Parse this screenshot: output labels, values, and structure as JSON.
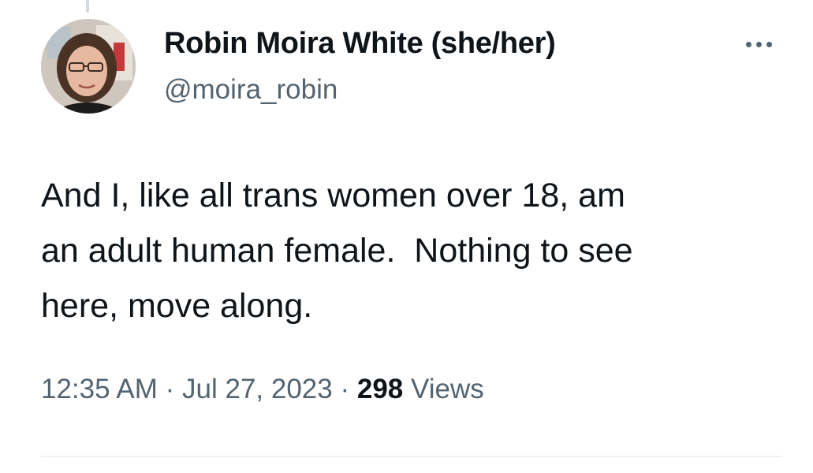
{
  "author": {
    "display_name": "Robin Moira White (she/her)",
    "handle": "@moira_robin"
  },
  "more_icon": "more-horizontal-icon",
  "tweet": {
    "text_lines": [
      "And I, like all trans women over 18, am",
      "an adult human female.  Nothing to see",
      "here, move along."
    ]
  },
  "meta": {
    "time": "12:35 AM",
    "separator": "·",
    "date": "Jul 27, 2023",
    "views_count": "298",
    "views_label": "Views"
  },
  "colors": {
    "primary_text": "#0f1419",
    "secondary_text": "#536471",
    "divider": "#eff3f4",
    "background": "#ffffff"
  }
}
